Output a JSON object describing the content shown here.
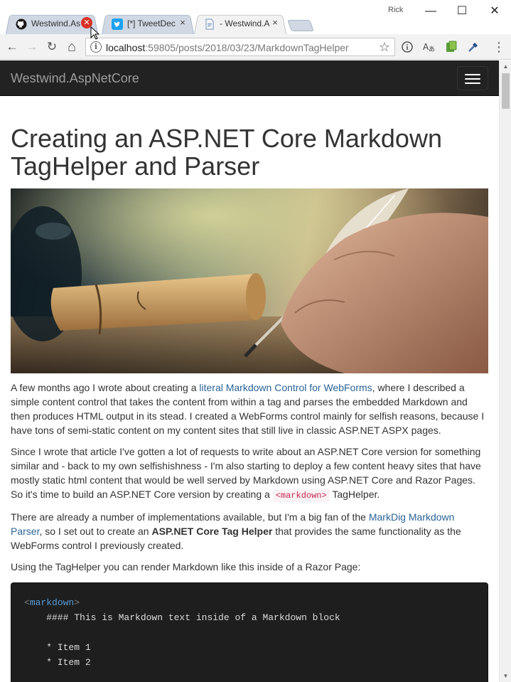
{
  "browser": {
    "profile_name": "Rick",
    "tabs": [
      {
        "label": "Westwind.As",
        "icon": "github-icon",
        "close": "✕",
        "active": false
      },
      {
        "label": "[*] TweetDec",
        "icon": "twitter-icon",
        "close": "×",
        "active": false
      },
      {
        "label": "- Westwind.A",
        "icon": "page-icon",
        "close": "×",
        "active": true
      }
    ],
    "window": {
      "minimize": "—",
      "maximize": "☐",
      "close": "✕"
    },
    "nav": {
      "back": "←",
      "forward": "→",
      "reload": "↻",
      "home": "⌂"
    },
    "address": {
      "host": "localhost",
      "path": ":59805/posts/2018/03/23/MarkdownTagHelper",
      "info_glyph": "i",
      "star": "☆"
    },
    "extensions": [
      "info-circle-icon",
      "translate-icon",
      "extension-icon",
      "eyedropper-icon"
    ],
    "menu": "⋮"
  },
  "site": {
    "brand": "Westwind.AspNetCore"
  },
  "article": {
    "title": "Creating an ASP.NET Core Markdown TagHelper and Parser",
    "p1": {
      "before": "A few months ago I wrote about creating a ",
      "link": "literal Markdown Control for WebForms",
      "after": ", where I described a simple content control that takes the content from within a tag and parses the embedded Markdown and then produces HTML output in its stead. I created a WebForms control mainly for selfish reasons, because I have tons of semi-static content on my content sites that still live in classic ASP.NET ASPX pages."
    },
    "p2": {
      "before": "Since I wrote that article I've gotten a lot of requests to write about an ASP.NET Core version for something similar and - back to my own selfishishness - I'm also starting to deploy a few content heavy sites that have mostly static html content that would be well served by Markdown using ASP.NET Core and Razor Pages. So it's time to build an ASP.NET Core version by creating a ",
      "code": "<markdown>",
      "after": " TagHelper."
    },
    "p3": {
      "before": "There are already a number of implementations available, but I'm a big fan of the ",
      "link": "MarkDig Markdown Parser",
      "middle": ", so I set out to create an ",
      "bold": "ASP.NET Core Tag Helper",
      "after": " that provides the same functionality as the WebForms control I previously created."
    },
    "p4": "Using the TagHelper you can render Markdown like this inside of a Razor Page:",
    "code": {
      "open_lt": "<",
      "tag": "markdown",
      "open_gt": ">",
      "lines": [
        "    #### This is Markdown text inside of a Markdown block",
        "",
        "    * Item 1",
        "    * Item 2"
      ]
    }
  }
}
